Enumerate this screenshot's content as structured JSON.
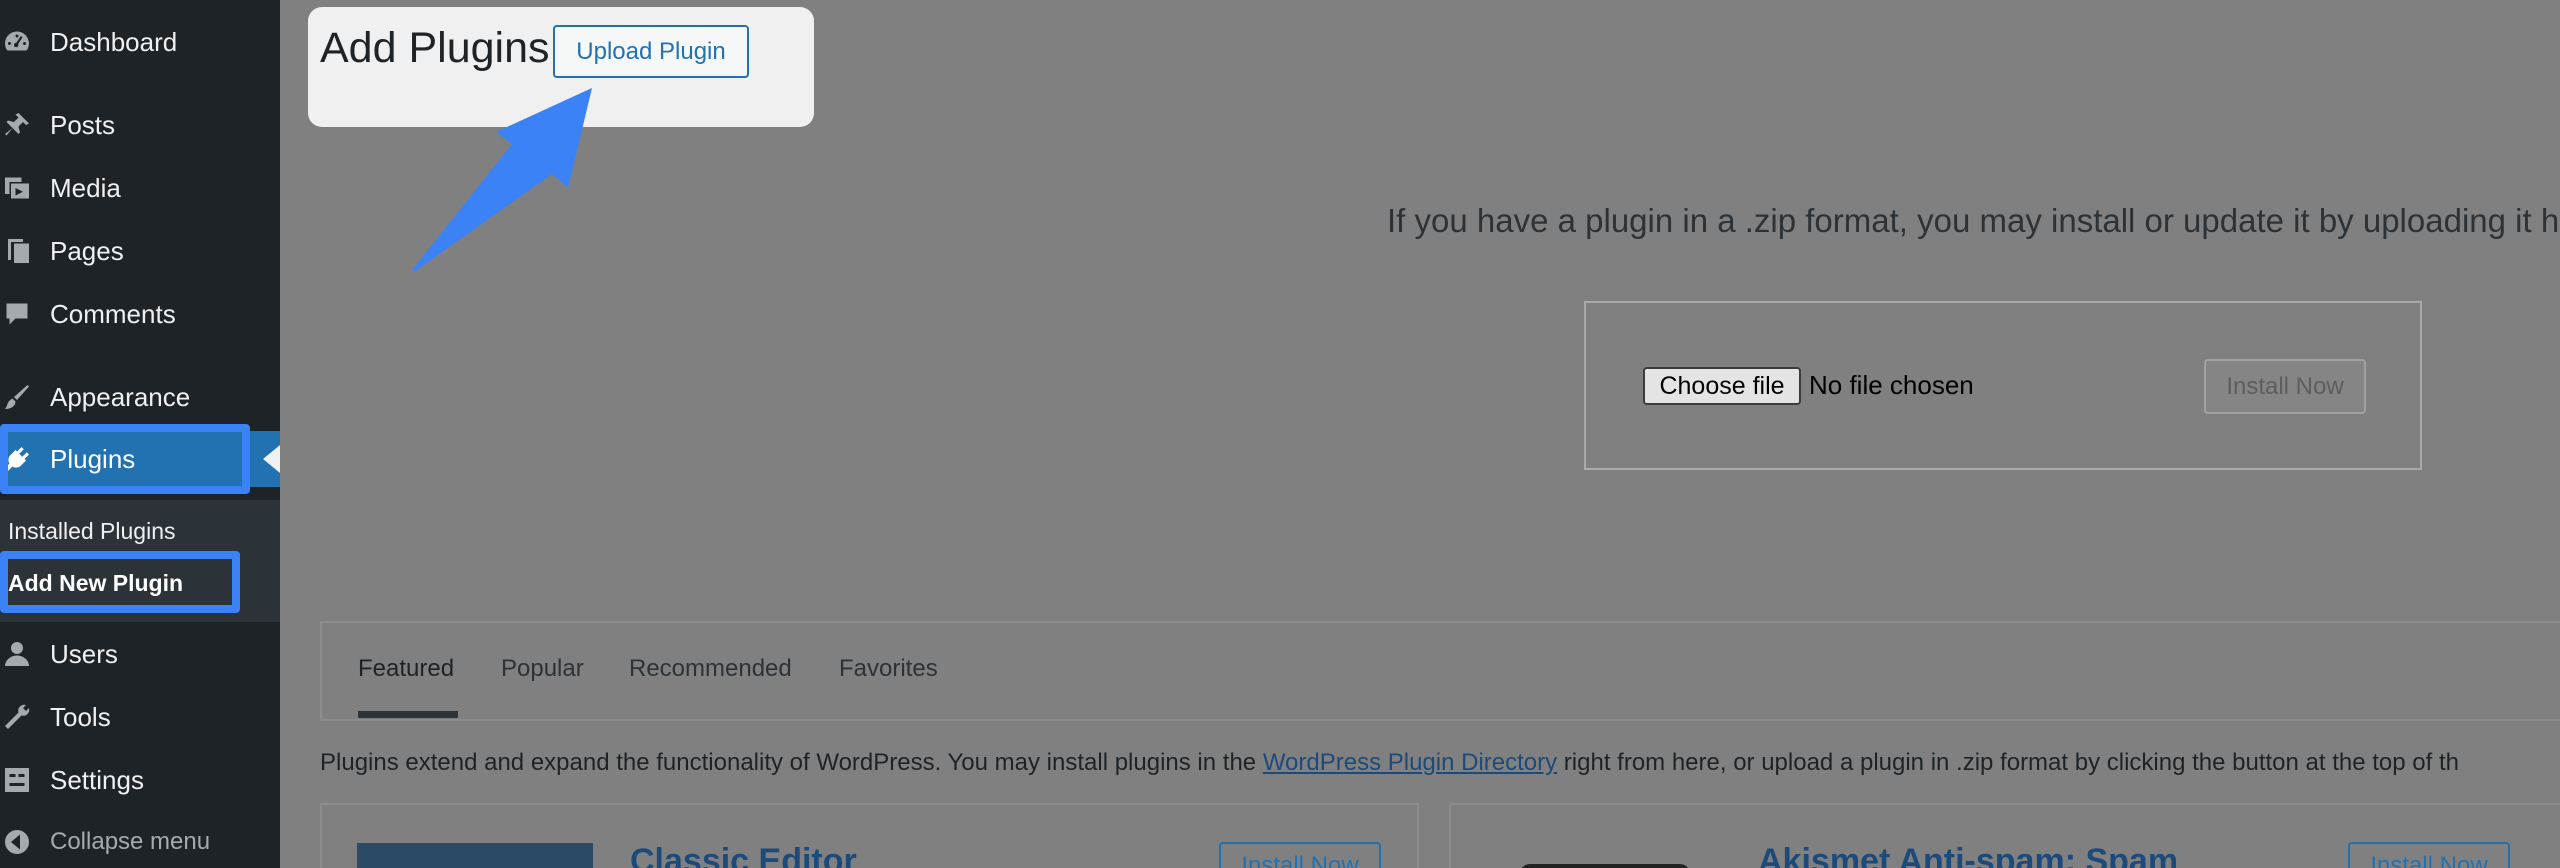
{
  "sidebar": {
    "items": [
      {
        "label": "Dashboard",
        "icon": "dashboard-icon"
      },
      {
        "label": "Posts",
        "icon": "pin-icon"
      },
      {
        "label": "Media",
        "icon": "media-icon"
      },
      {
        "label": "Pages",
        "icon": "pages-icon"
      },
      {
        "label": "Comments",
        "icon": "comment-icon"
      },
      {
        "label": "Appearance",
        "icon": "brush-icon"
      },
      {
        "label": "Plugins",
        "icon": "plugin-icon"
      },
      {
        "label": "Users",
        "icon": "user-icon"
      },
      {
        "label": "Tools",
        "icon": "wrench-icon"
      },
      {
        "label": "Settings",
        "icon": "settings-icon"
      }
    ],
    "submenu": [
      "Installed Plugins",
      "Add New Plugin"
    ],
    "collapse_label": "Collapse menu"
  },
  "header": {
    "title": "Add Plugins",
    "upload_button": "Upload Plugin"
  },
  "upload": {
    "help_text": "If you have a plugin in a .zip format, you may install or update it by uploading it h",
    "choose_file": "Choose file",
    "no_file": "No file chosen",
    "install_now": "Install Now"
  },
  "tabs": [
    "Featured",
    "Popular",
    "Recommended",
    "Favorites"
  ],
  "intro": {
    "before": "Plugins extend and expand the functionality of WordPress. You may install plugins in the ",
    "link": "WordPress Plugin Directory",
    "after": " right from here, or upload a plugin in .zip format by clicking the button at the top of th"
  },
  "cards": [
    {
      "title": "Classic Editor",
      "button": "Install Now"
    },
    {
      "title": "Akismet Anti-spam: Spam",
      "button": "Install Now"
    }
  ],
  "colors": {
    "highlight": "#3b82f6",
    "admin_blue": "#2271b1",
    "sidebar_bg": "#1d2327"
  }
}
